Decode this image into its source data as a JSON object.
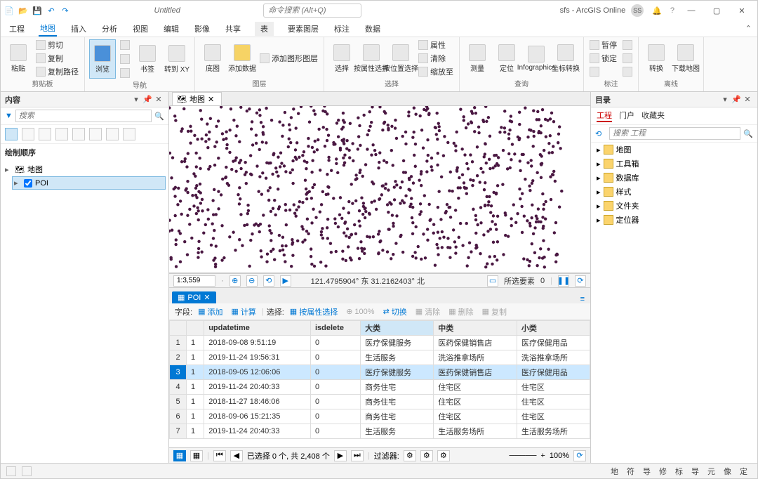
{
  "title": "Untitled",
  "search_placeholder": "命令搜索 (Alt+Q)",
  "user_text": "sfs - ArcGIS Online",
  "user_badge": "SS",
  "ribbon_tabs": [
    "工程",
    "地图",
    "插入",
    "分析",
    "视图",
    "编辑",
    "影像",
    "共享"
  ],
  "ribbon_ctx_group": "表",
  "ribbon_ctx": [
    "要素图层",
    "标注",
    "数据"
  ],
  "ribbon_active": 1,
  "clipboard": {
    "label": "剪贴板",
    "paste": "粘贴",
    "cut": "剪切",
    "copy": "复制",
    "copypath": "复制路径"
  },
  "nav": {
    "label": "导航",
    "browse": "浏览",
    "bookmark": "书签",
    "goto": "转到\nXY"
  },
  "layer": {
    "label": "图层",
    "basemap": "底图",
    "adddata": "添加数据",
    "addgraphic": "添加图形图层"
  },
  "sel": {
    "label": "选择",
    "select": "选择",
    "byattr": "按属性选择",
    "byloc": "按位置选择",
    "attrs": "属性",
    "clear": "清除",
    "zoomto": "缩放至"
  },
  "query": {
    "label": "查询",
    "measure": "测量",
    "locate": "定位",
    "infog": "Infographics",
    "coord": "坐标转换"
  },
  "labeling": {
    "label": "标注",
    "pause": "暂停",
    "lock": "锁定"
  },
  "offline": {
    "label": "离线",
    "convert": "转换",
    "download": "下载地图"
  },
  "contents": {
    "title": "内容",
    "search": "搜索",
    "section": "绘制顺序",
    "map": "地图",
    "layer": "POI"
  },
  "map_tab": "地图",
  "status": {
    "scale": "1:3,559",
    "coords": "121.4795904° 东 31.2162403° 北",
    "sel_label": "所选要素",
    "sel_count": "0"
  },
  "table": {
    "tab": "POI",
    "field_lbl": "字段:",
    "add": "添加",
    "calc": "计算",
    "sel_lbl": "选择:",
    "byattr": "按属性选择",
    "zoom": "100%",
    "switch": "切换",
    "clear": "清除",
    "del": "删除",
    "copy": "复制",
    "cols": [
      "",
      "",
      "updatetime",
      "isdelete",
      "大类",
      "中类",
      "小类"
    ],
    "rows": [
      [
        "1",
        "1",
        "2018-09-08 9:51:19",
        "0",
        "医疗保健服务",
        "医药保健销售店",
        "医疗保健用品"
      ],
      [
        "2",
        "1",
        "2019-11-24 19:56:31",
        "0",
        "生活服务",
        "洗浴推拿场所",
        "洗浴推拿场所"
      ],
      [
        "3",
        "1",
        "2018-09-05 12:06:06",
        "0",
        "医疗保健服务",
        "医药保健销售店",
        "医疗保健用品"
      ],
      [
        "4",
        "1",
        "2019-11-24 20:40:33",
        "0",
        "商务住宅",
        "住宅区",
        "住宅区"
      ],
      [
        "5",
        "1",
        "2018-11-27 18:46:06",
        "0",
        "商务住宅",
        "住宅区",
        "住宅区"
      ],
      [
        "6",
        "1",
        "2018-09-06 15:21:35",
        "0",
        "商务住宅",
        "住宅区",
        "住宅区"
      ],
      [
        "7",
        "1",
        "2019-11-24 20:40:33",
        "0",
        "生活服务",
        "生活服务场所",
        "生活服务场所"
      ]
    ],
    "selected_row": 2,
    "status": "已选择 0 个, 共 2,408 个",
    "filter": "过滤器:"
  },
  "catalog": {
    "title": "目录",
    "tabs": [
      "工程",
      "门户",
      "收藏夹"
    ],
    "active": 0,
    "search": "搜索 工程",
    "items": [
      "地图",
      "工具箱",
      "数据库",
      "样式",
      "文件夹",
      "定位器"
    ]
  },
  "footer": [
    "地",
    "符",
    "导",
    "修",
    "标",
    "导",
    "元",
    "像",
    "定"
  ]
}
